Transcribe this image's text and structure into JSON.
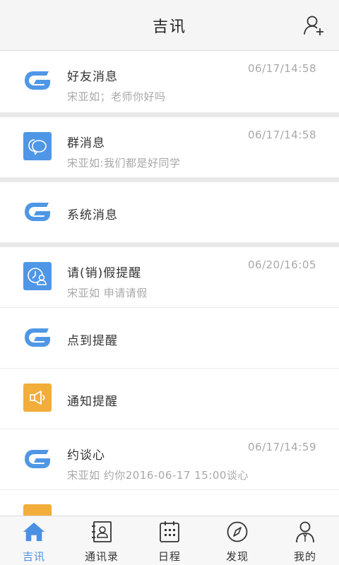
{
  "header": {
    "title": "吉讯",
    "action_icon": "add-contact-icon"
  },
  "colors": {
    "accent": "#4a90e2",
    "blue_tile": "#4f97e6",
    "orange_tile": "#f2ad3b",
    "muted_text": "#a8a8a8"
  },
  "messages": [
    {
      "title": "好友消息",
      "subtitle": "宋亚如；老师你好吗",
      "time": "06/17/14:58",
      "icon": "logo-g-icon"
    },
    {
      "title": "群消息",
      "subtitle": "宋亚如:我们都是好同学",
      "time": "06/17/14:58",
      "icon": "chat-bubbles-icon"
    },
    {
      "title": "系统消息",
      "subtitle": "",
      "time": "",
      "icon": "logo-g-icon"
    },
    {
      "title": "请(销)假提醒",
      "subtitle": "宋亚如  申请请假",
      "time": "06/20/16:05",
      "icon": "leave-clock-person-icon"
    },
    {
      "title": "点到提醒",
      "subtitle": "",
      "time": "",
      "icon": "logo-g-icon"
    },
    {
      "title": "通知提醒",
      "subtitle": "",
      "time": "",
      "icon": "megaphone-icon"
    },
    {
      "title": "约谈心",
      "subtitle": "宋亚如  约你2016-06-17  15:00谈心",
      "time": "06/17/14:59",
      "icon": "logo-g-icon"
    }
  ],
  "tabs": [
    {
      "label": "吉讯",
      "icon": "home-icon",
      "active": true
    },
    {
      "label": "通讯录",
      "icon": "contacts-book-icon",
      "active": false
    },
    {
      "label": "日程",
      "icon": "calendar-icon",
      "active": false
    },
    {
      "label": "发现",
      "icon": "compass-icon",
      "active": false
    },
    {
      "label": "我的",
      "icon": "profile-icon",
      "active": false
    }
  ]
}
